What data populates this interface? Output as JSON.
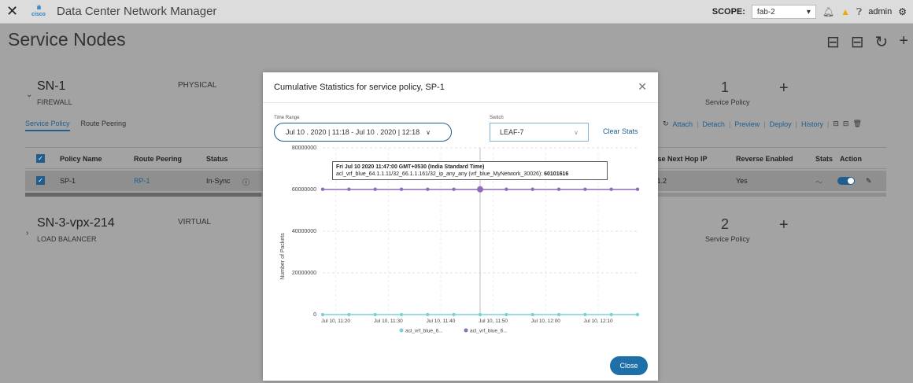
{
  "topbar": {
    "app_title": "Data Center Network Manager",
    "logo_text": "cisco",
    "scope_label": "SCOPE:",
    "scope_value": "fab-2",
    "user": "admin"
  },
  "page": {
    "title": "Service Nodes"
  },
  "nodes": [
    {
      "name": "SN-1",
      "type": "PHYSICAL",
      "subtype": "FIREWALL",
      "policy_count": "1",
      "policy_label": "Service Policy",
      "tabs": [
        "Service Policy",
        "Route Peering"
      ],
      "actions": [
        "Attach",
        "Detach",
        "Preview",
        "Deploy",
        "History"
      ],
      "columns": [
        "Policy Name",
        "Route Peering",
        "Status",
        "rse Next Hop IP",
        "Reverse Enabled",
        "Stats",
        "Action"
      ],
      "row": {
        "policy_name": "SP-1",
        "route_peering": "RP-1",
        "status": "In-Sync",
        "next_hop": ".1.2",
        "reverse_enabled": "Yes"
      }
    },
    {
      "name": "SN-3-vpx-214",
      "type": "VIRTUAL",
      "subtype": "LOAD BALANCER",
      "policy_count": "2",
      "policy_label": "Service Policy"
    }
  ],
  "modal": {
    "title": "Cumulative Statistics for service policy, SP-1",
    "time_range_label": "Time Range",
    "time_range_value": "Jul 10 . 2020 | 11:18 - Jul 10 . 2020 | 12:18",
    "switch_label": "Switch",
    "switch_value": "LEAF-7",
    "clear_stats": "Clear Stats",
    "close_button": "Close",
    "tooltip_title": "Fri Jul 10 2020 11:47:00 GMT+0530 (India Standard Time)",
    "tooltip_series": "acl_vrf_blue_64.1.1.11/32_66.1.1.161/32_ip_any_any (vrf_blue_MyNetwork_30026):",
    "tooltip_value": "60101616"
  },
  "chart_data": {
    "type": "line",
    "ylabel": "Number of Packets",
    "ylim": [
      0,
      80000000
    ],
    "yticks": [
      "80000000",
      "60000000",
      "40000000",
      "20000000",
      "0"
    ],
    "xticks": [
      "Jul 10, 11:20",
      "Jul 10, 11:30",
      "Jul 10, 11:40",
      "Jul 10, 11:50",
      "Jul 10, 12:00",
      "Jul 10, 12:10"
    ],
    "x": [
      "11:17",
      "11:22",
      "11:27",
      "11:32",
      "11:37",
      "11:42",
      "11:47",
      "11:52",
      "11:57",
      "12:02",
      "12:07",
      "12:12",
      "12:17"
    ],
    "series": [
      {
        "name": "acl_vrf_blue_6...",
        "color": "#7ecfd8",
        "values": [
          0,
          0,
          0,
          0,
          0,
          0,
          0,
          0,
          0,
          0,
          0,
          0,
          0
        ]
      },
      {
        "name": "acl_vrf_blue_6...",
        "color": "#8e6bbf",
        "values": [
          60101616,
          60101616,
          60101616,
          60101616,
          60101616,
          60101616,
          60101616,
          60101616,
          60101616,
          60101616,
          60101616,
          60101616,
          60101616
        ]
      }
    ],
    "highlight_index": 6
  }
}
